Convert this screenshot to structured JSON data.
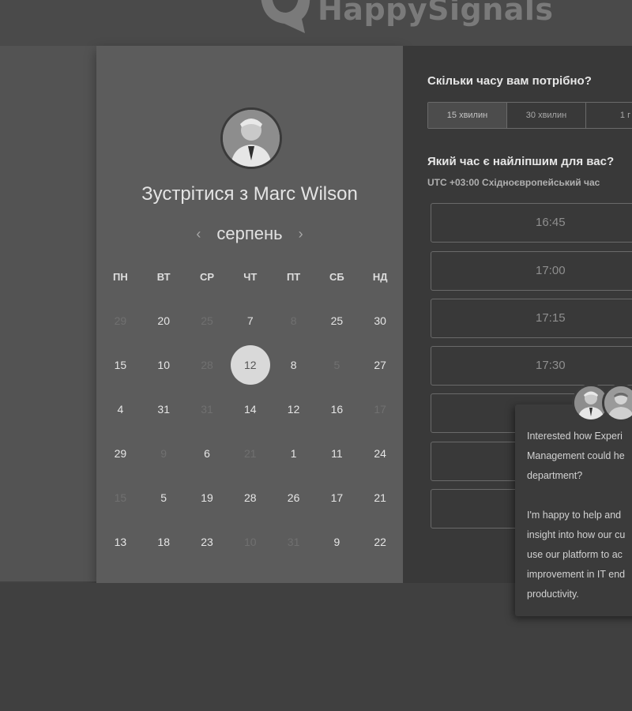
{
  "brand": {
    "name": "HappySignals"
  },
  "calendar": {
    "title": "Зустрітися з Marc Wilson",
    "month": "серпень",
    "prev_icon": "‹",
    "next_icon": "›",
    "weekdays": [
      "ПН",
      "ВТ",
      "СР",
      "ЧТ",
      "ПТ",
      "СБ",
      "НД"
    ],
    "weeks": [
      [
        {
          "d": "29",
          "m": 1
        },
        {
          "d": "20",
          "m": 0
        },
        {
          "d": "25",
          "m": 1
        },
        {
          "d": "7",
          "m": 0
        },
        {
          "d": "8",
          "m": 1
        },
        {
          "d": "25",
          "m": 0
        },
        {
          "d": "30",
          "m": 0
        }
      ],
      [
        {
          "d": "15",
          "m": 0
        },
        {
          "d": "10",
          "m": 0
        },
        {
          "d": "28",
          "m": 1
        },
        {
          "d": "12",
          "m": 0,
          "s": 1
        },
        {
          "d": "8",
          "m": 0
        },
        {
          "d": "5",
          "m": 1
        },
        {
          "d": "27",
          "m": 0
        }
      ],
      [
        {
          "d": "4",
          "m": 0
        },
        {
          "d": "31",
          "m": 0
        },
        {
          "d": "31",
          "m": 1
        },
        {
          "d": "14",
          "m": 0
        },
        {
          "d": "12",
          "m": 0
        },
        {
          "d": "16",
          "m": 0
        },
        {
          "d": "17",
          "m": 1
        }
      ],
      [
        {
          "d": "29",
          "m": 0
        },
        {
          "d": "9",
          "m": 1
        },
        {
          "d": "6",
          "m": 0
        },
        {
          "d": "21",
          "m": 1
        },
        {
          "d": "1",
          "m": 0
        },
        {
          "d": "11",
          "m": 0
        },
        {
          "d": "24",
          "m": 0
        }
      ],
      [
        {
          "d": "15",
          "m": 1
        },
        {
          "d": "5",
          "m": 0
        },
        {
          "d": "19",
          "m": 0
        },
        {
          "d": "28",
          "m": 0
        },
        {
          "d": "26",
          "m": 0
        },
        {
          "d": "17",
          "m": 0
        },
        {
          "d": "21",
          "m": 0
        }
      ],
      [
        {
          "d": "13",
          "m": 0
        },
        {
          "d": "18",
          "m": 0
        },
        {
          "d": "23",
          "m": 0
        },
        {
          "d": "10",
          "m": 1
        },
        {
          "d": "31",
          "m": 1
        },
        {
          "d": "9",
          "m": 0
        },
        {
          "d": "22",
          "m": 0
        }
      ]
    ]
  },
  "booking": {
    "duration_question": "Скільки часу вам потрібно?",
    "durations": [
      "15 хвилин",
      "30 хвилин",
      "1 г"
    ],
    "time_question": "Який час є найліпшим для вас?",
    "timezone": "UTC +03:00 Східноєвропейський час",
    "slots": [
      "16:45",
      "17:00",
      "17:15",
      "17:30",
      "",
      "",
      ""
    ]
  },
  "chat": {
    "message": "Interested how Experi\nManagement could he\ndepartment?\n\nI'm happy to help and\ninsight into how our cu\nuse our platform to ac\nimprovement in IT end\nproductivity."
  }
}
